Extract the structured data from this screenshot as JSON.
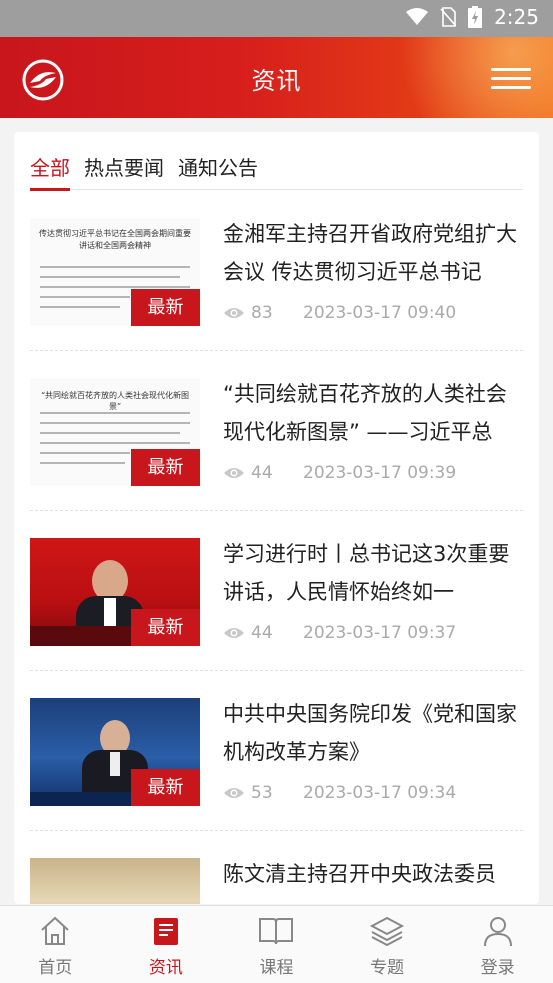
{
  "status": {
    "time": "2:25"
  },
  "header": {
    "title": "资讯"
  },
  "tabs": [
    {
      "label": "全部",
      "active": true
    },
    {
      "label": "热点要闻",
      "active": false
    },
    {
      "label": "通知公告",
      "active": false
    }
  ],
  "news": [
    {
      "title": "金湘军主持召开省政府党组扩大会议 传达贯彻习近平总书记",
      "views": "83",
      "date": "2023-03-17 09:40",
      "badge": "最新",
      "thumb_heading": "传达贯彻习近平总书记在全国两会期间重要讲话和全国两会精神"
    },
    {
      "title": "“共同绘就百花齐放的人类社会现代化新图景” ——习近平总",
      "views": "44",
      "date": "2023-03-17 09:39",
      "badge": "最新",
      "thumb_heading": "“共同绘就百花齐放的人类社会现代化新图景”"
    },
    {
      "title": "学习进行时丨总书记这3次重要讲话，人民情怀始终如一",
      "views": "44",
      "date": "2023-03-17 09:37",
      "badge": "最新"
    },
    {
      "title": "中共中央国务院印发《党和国家机构改革方案》",
      "views": "53",
      "date": "2023-03-17 09:34",
      "badge": "最新"
    },
    {
      "title": "陈文清主持召开中央政法委员",
      "views": "",
      "date": "",
      "badge": ""
    }
  ],
  "bottom_nav": [
    {
      "label": "首页",
      "icon": "home-icon",
      "active": false
    },
    {
      "label": "资讯",
      "icon": "news-icon",
      "active": true
    },
    {
      "label": "课程",
      "icon": "book-icon",
      "active": false
    },
    {
      "label": "专题",
      "icon": "layers-icon",
      "active": false
    },
    {
      "label": "登录",
      "icon": "user-icon",
      "active": false
    }
  ],
  "colors": {
    "brand": "#c8161d"
  }
}
